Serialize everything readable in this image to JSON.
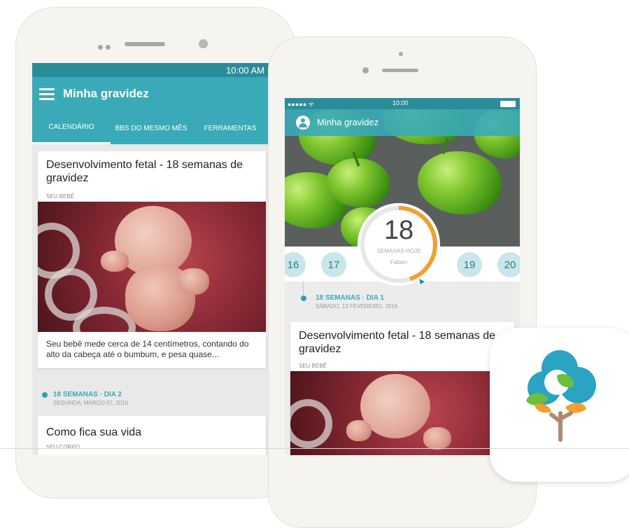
{
  "android": {
    "status_time": "10:00 AM",
    "app_title": "Minha gravidez",
    "tabs": [
      "CALENDÁRIO",
      "BBS DO MESMO MÊS",
      "FERRAMENTAS"
    ],
    "card1": {
      "title": "Desenvolvimento fetal - 18 semanas de gravidez",
      "category": "SEU BEBÊ",
      "excerpt": "Seu bebê mede cerca de 14 centímetros, contando do alto da cabeça até o bumbum, e pesa quase..."
    },
    "timeline": {
      "title": "18 SEMANAS · DIA 2",
      "date": "SEGUNDA, MARÇO 07, 2016"
    },
    "card2": {
      "title": "Como fica sua vida",
      "category": "SEU CORPO"
    }
  },
  "ios": {
    "carrier": "●●●●● ᯤ",
    "status_time": "10:00",
    "app_title": "Minha gravidez",
    "current_week": "18",
    "weeks_label": "SEMANAS HOJE",
    "remaining_label": "Faltam",
    "week_bubbles": [
      "16",
      "17",
      "19",
      "20"
    ],
    "progress_fraction": 0.45,
    "timeline": {
      "title": "18 SEMANAS · DIA 1",
      "date": "SÁBADO, 13 FEVEREIRO, 2016"
    },
    "card": {
      "title": "Desenvolvimento fetal - 18 semanas de gravidez",
      "category": "SEU BEBÊ"
    }
  },
  "colors": {
    "teal": "#3aaab8",
    "teal_dark": "#2b8c99",
    "orange": "#f0a030"
  }
}
